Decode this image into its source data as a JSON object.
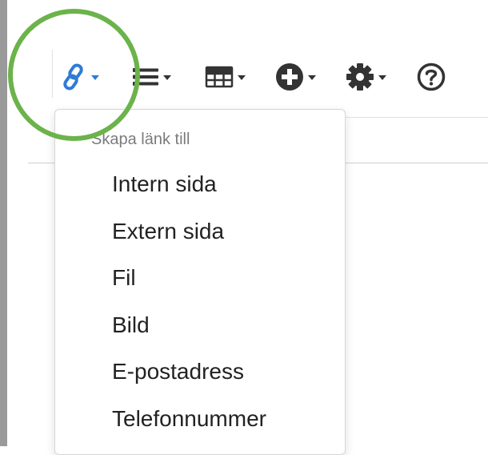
{
  "toolbar": {
    "buttons": [
      {
        "name": "link-button",
        "icon": "link-icon",
        "has_caret": true,
        "active": true
      },
      {
        "name": "list-button",
        "icon": "list-icon",
        "has_caret": true
      },
      {
        "name": "table-button",
        "icon": "table-icon",
        "has_caret": true
      },
      {
        "name": "insert-button",
        "icon": "plus-circle-icon",
        "has_caret": true
      },
      {
        "name": "settings-button",
        "icon": "gear-icon",
        "has_caret": true
      },
      {
        "name": "help-button",
        "icon": "question-circle-icon",
        "has_caret": false
      }
    ]
  },
  "link_menu": {
    "header": "Skapa länk till",
    "items": [
      "Intern sida",
      "Extern sida",
      "Fil",
      "Bild",
      "E-postadress",
      "Telefonnummer"
    ]
  },
  "colors": {
    "accent": "#2f7bd6",
    "highlight": "#6bb34a",
    "icon": "#333333",
    "menu_header": "#7b7b7b",
    "menu_text": "#222222"
  }
}
